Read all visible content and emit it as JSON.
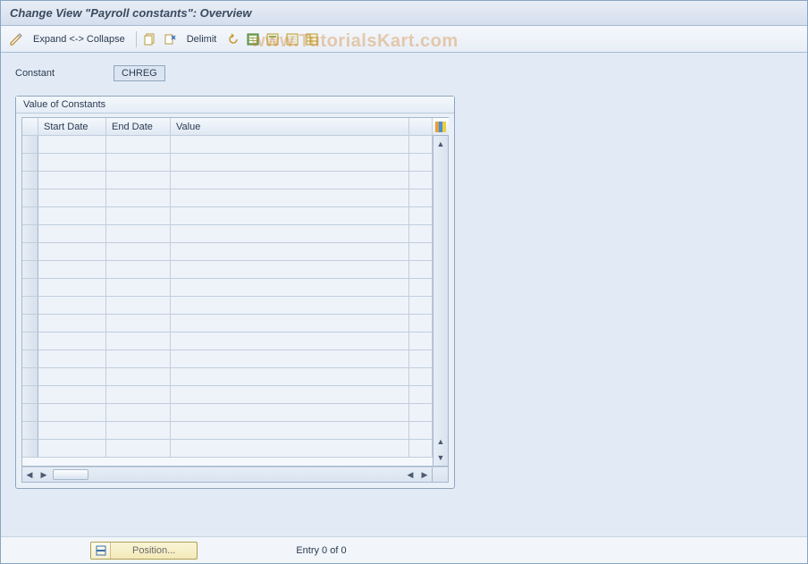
{
  "header": {
    "title": "Change View \"Payroll constants\": Overview"
  },
  "toolbar": {
    "expand_collapse_label": "Expand <-> Collapse",
    "delimit_label": "Delimit"
  },
  "form": {
    "constant_label": "Constant",
    "constant_value": "CHREG"
  },
  "panel": {
    "title": "Value of Constants",
    "columns": {
      "start": "Start Date",
      "end": "End Date",
      "value": "Value"
    },
    "rows": [
      {
        "start": "",
        "end": "",
        "value": ""
      },
      {
        "start": "",
        "end": "",
        "value": ""
      },
      {
        "start": "",
        "end": "",
        "value": ""
      },
      {
        "start": "",
        "end": "",
        "value": ""
      },
      {
        "start": "",
        "end": "",
        "value": ""
      },
      {
        "start": "",
        "end": "",
        "value": ""
      },
      {
        "start": "",
        "end": "",
        "value": ""
      },
      {
        "start": "",
        "end": "",
        "value": ""
      },
      {
        "start": "",
        "end": "",
        "value": ""
      },
      {
        "start": "",
        "end": "",
        "value": ""
      },
      {
        "start": "",
        "end": "",
        "value": ""
      },
      {
        "start": "",
        "end": "",
        "value": ""
      },
      {
        "start": "",
        "end": "",
        "value": ""
      },
      {
        "start": "",
        "end": "",
        "value": ""
      },
      {
        "start": "",
        "end": "",
        "value": ""
      },
      {
        "start": "",
        "end": "",
        "value": ""
      },
      {
        "start": "",
        "end": "",
        "value": ""
      },
      {
        "start": "",
        "end": "",
        "value": ""
      }
    ]
  },
  "footer": {
    "position_label": "Position...",
    "entry_text": "Entry 0 of 0"
  },
  "watermark": "www.TutorialsKart.com"
}
